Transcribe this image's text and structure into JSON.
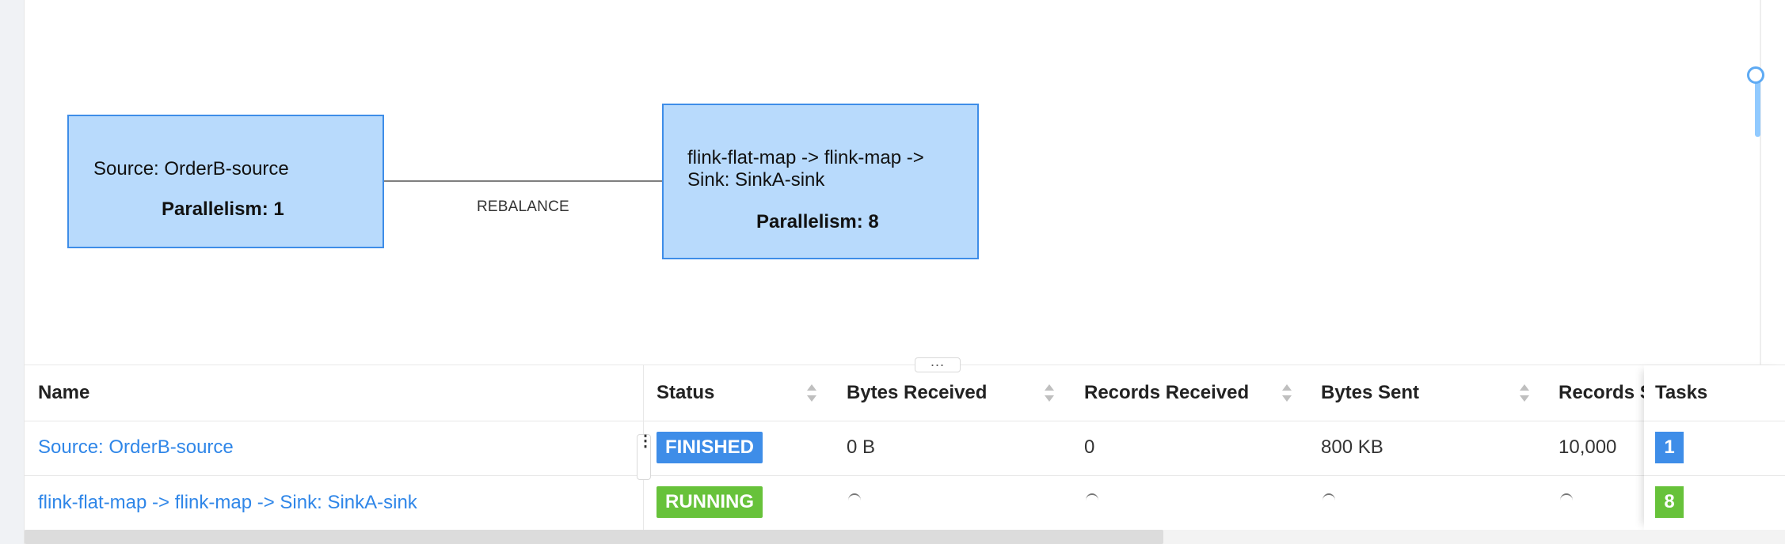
{
  "graph": {
    "nodes": [
      {
        "title": "Source: OrderB-source",
        "parallelism": "Parallelism: 1"
      },
      {
        "title": "flink-flat-map -> flink-map -> Sink: SinkA-sink",
        "parallelism": "Parallelism: 8"
      }
    ],
    "edge_label": "REBALANCE",
    "colors": {
      "node_fill": "#b8dafc",
      "node_border": "#3e8de8"
    }
  },
  "resize_handle": "...",
  "table": {
    "columns": [
      "Name",
      "Status",
      "Bytes Received",
      "Records Received",
      "Bytes Sent",
      "Records Sent",
      "Tasks"
    ],
    "visible_header_truncated": "Records S",
    "rows": [
      {
        "name": "Source: OrderB-source",
        "status": "FINISHED",
        "bytes_received": "0 B",
        "records_received": "0",
        "bytes_sent": "800 KB",
        "records_sent": "10,000",
        "tasks": "1"
      },
      {
        "name": "flink-flat-map -> flink-map -> Sink: SinkA-sink",
        "status": "RUNNING",
        "bytes_received": "",
        "records_received": "",
        "bytes_sent": "",
        "records_sent": "",
        "tasks": "8"
      }
    ],
    "colors": {
      "finished": "#3e8de8",
      "running": "#67c23a",
      "link": "#2f86e8"
    }
  }
}
